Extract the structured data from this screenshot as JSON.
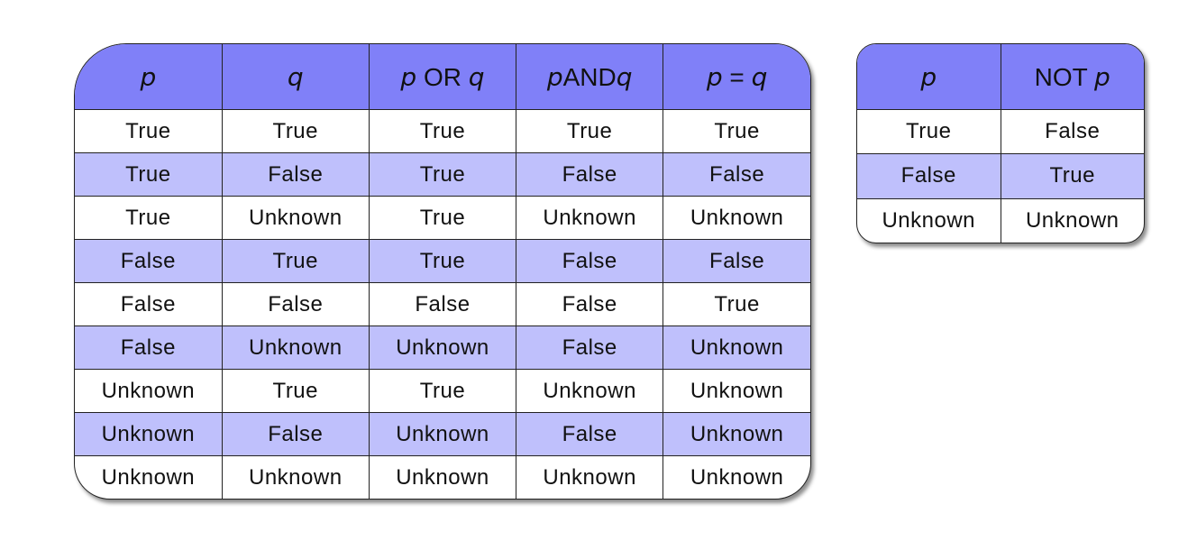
{
  "colors": {
    "header_bg": "#8080f8",
    "stripe_bg": "#bfc0fc",
    "row_bg": "#ffffff",
    "border": "#222222"
  },
  "binary_table": {
    "headers": [
      {
        "parts": [
          {
            "text": "p",
            "italic": true
          }
        ]
      },
      {
        "parts": [
          {
            "text": "q",
            "italic": true
          }
        ]
      },
      {
        "parts": [
          {
            "text": "p",
            "italic": true
          },
          {
            "text": " OR ",
            "italic": false
          },
          {
            "text": "q",
            "italic": true
          }
        ]
      },
      {
        "parts": [
          {
            "text": "p",
            "italic": true
          },
          {
            "text": "AND",
            "italic": false
          },
          {
            "text": "q",
            "italic": true
          }
        ]
      },
      {
        "parts": [
          {
            "text": "p",
            "italic": true
          },
          {
            "text": " = ",
            "italic": false
          },
          {
            "text": "q",
            "italic": true
          }
        ]
      }
    ],
    "rows": [
      [
        "True",
        "True",
        "True",
        "True",
        "True"
      ],
      [
        "True",
        "False",
        "True",
        "False",
        "False"
      ],
      [
        "True",
        "Unknown",
        "True",
        "Unknown",
        "Unknown"
      ],
      [
        "False",
        "True",
        "True",
        "False",
        "False"
      ],
      [
        "False",
        "False",
        "False",
        "False",
        "True"
      ],
      [
        "False",
        "Unknown",
        "Unknown",
        "False",
        "Unknown"
      ],
      [
        "Unknown",
        "True",
        "True",
        "Unknown",
        "Unknown"
      ],
      [
        "Unknown",
        "False",
        "Unknown",
        "False",
        "Unknown"
      ],
      [
        "Unknown",
        "Unknown",
        "Unknown",
        "Unknown",
        "Unknown"
      ]
    ]
  },
  "not_table": {
    "headers": [
      {
        "parts": [
          {
            "text": "p",
            "italic": true
          }
        ]
      },
      {
        "parts": [
          {
            "text": "NOT ",
            "italic": false
          },
          {
            "text": "p",
            "italic": true
          }
        ]
      }
    ],
    "rows": [
      [
        "True",
        "False"
      ],
      [
        "False",
        "True"
      ],
      [
        "Unknown",
        "Unknown"
      ]
    ]
  }
}
